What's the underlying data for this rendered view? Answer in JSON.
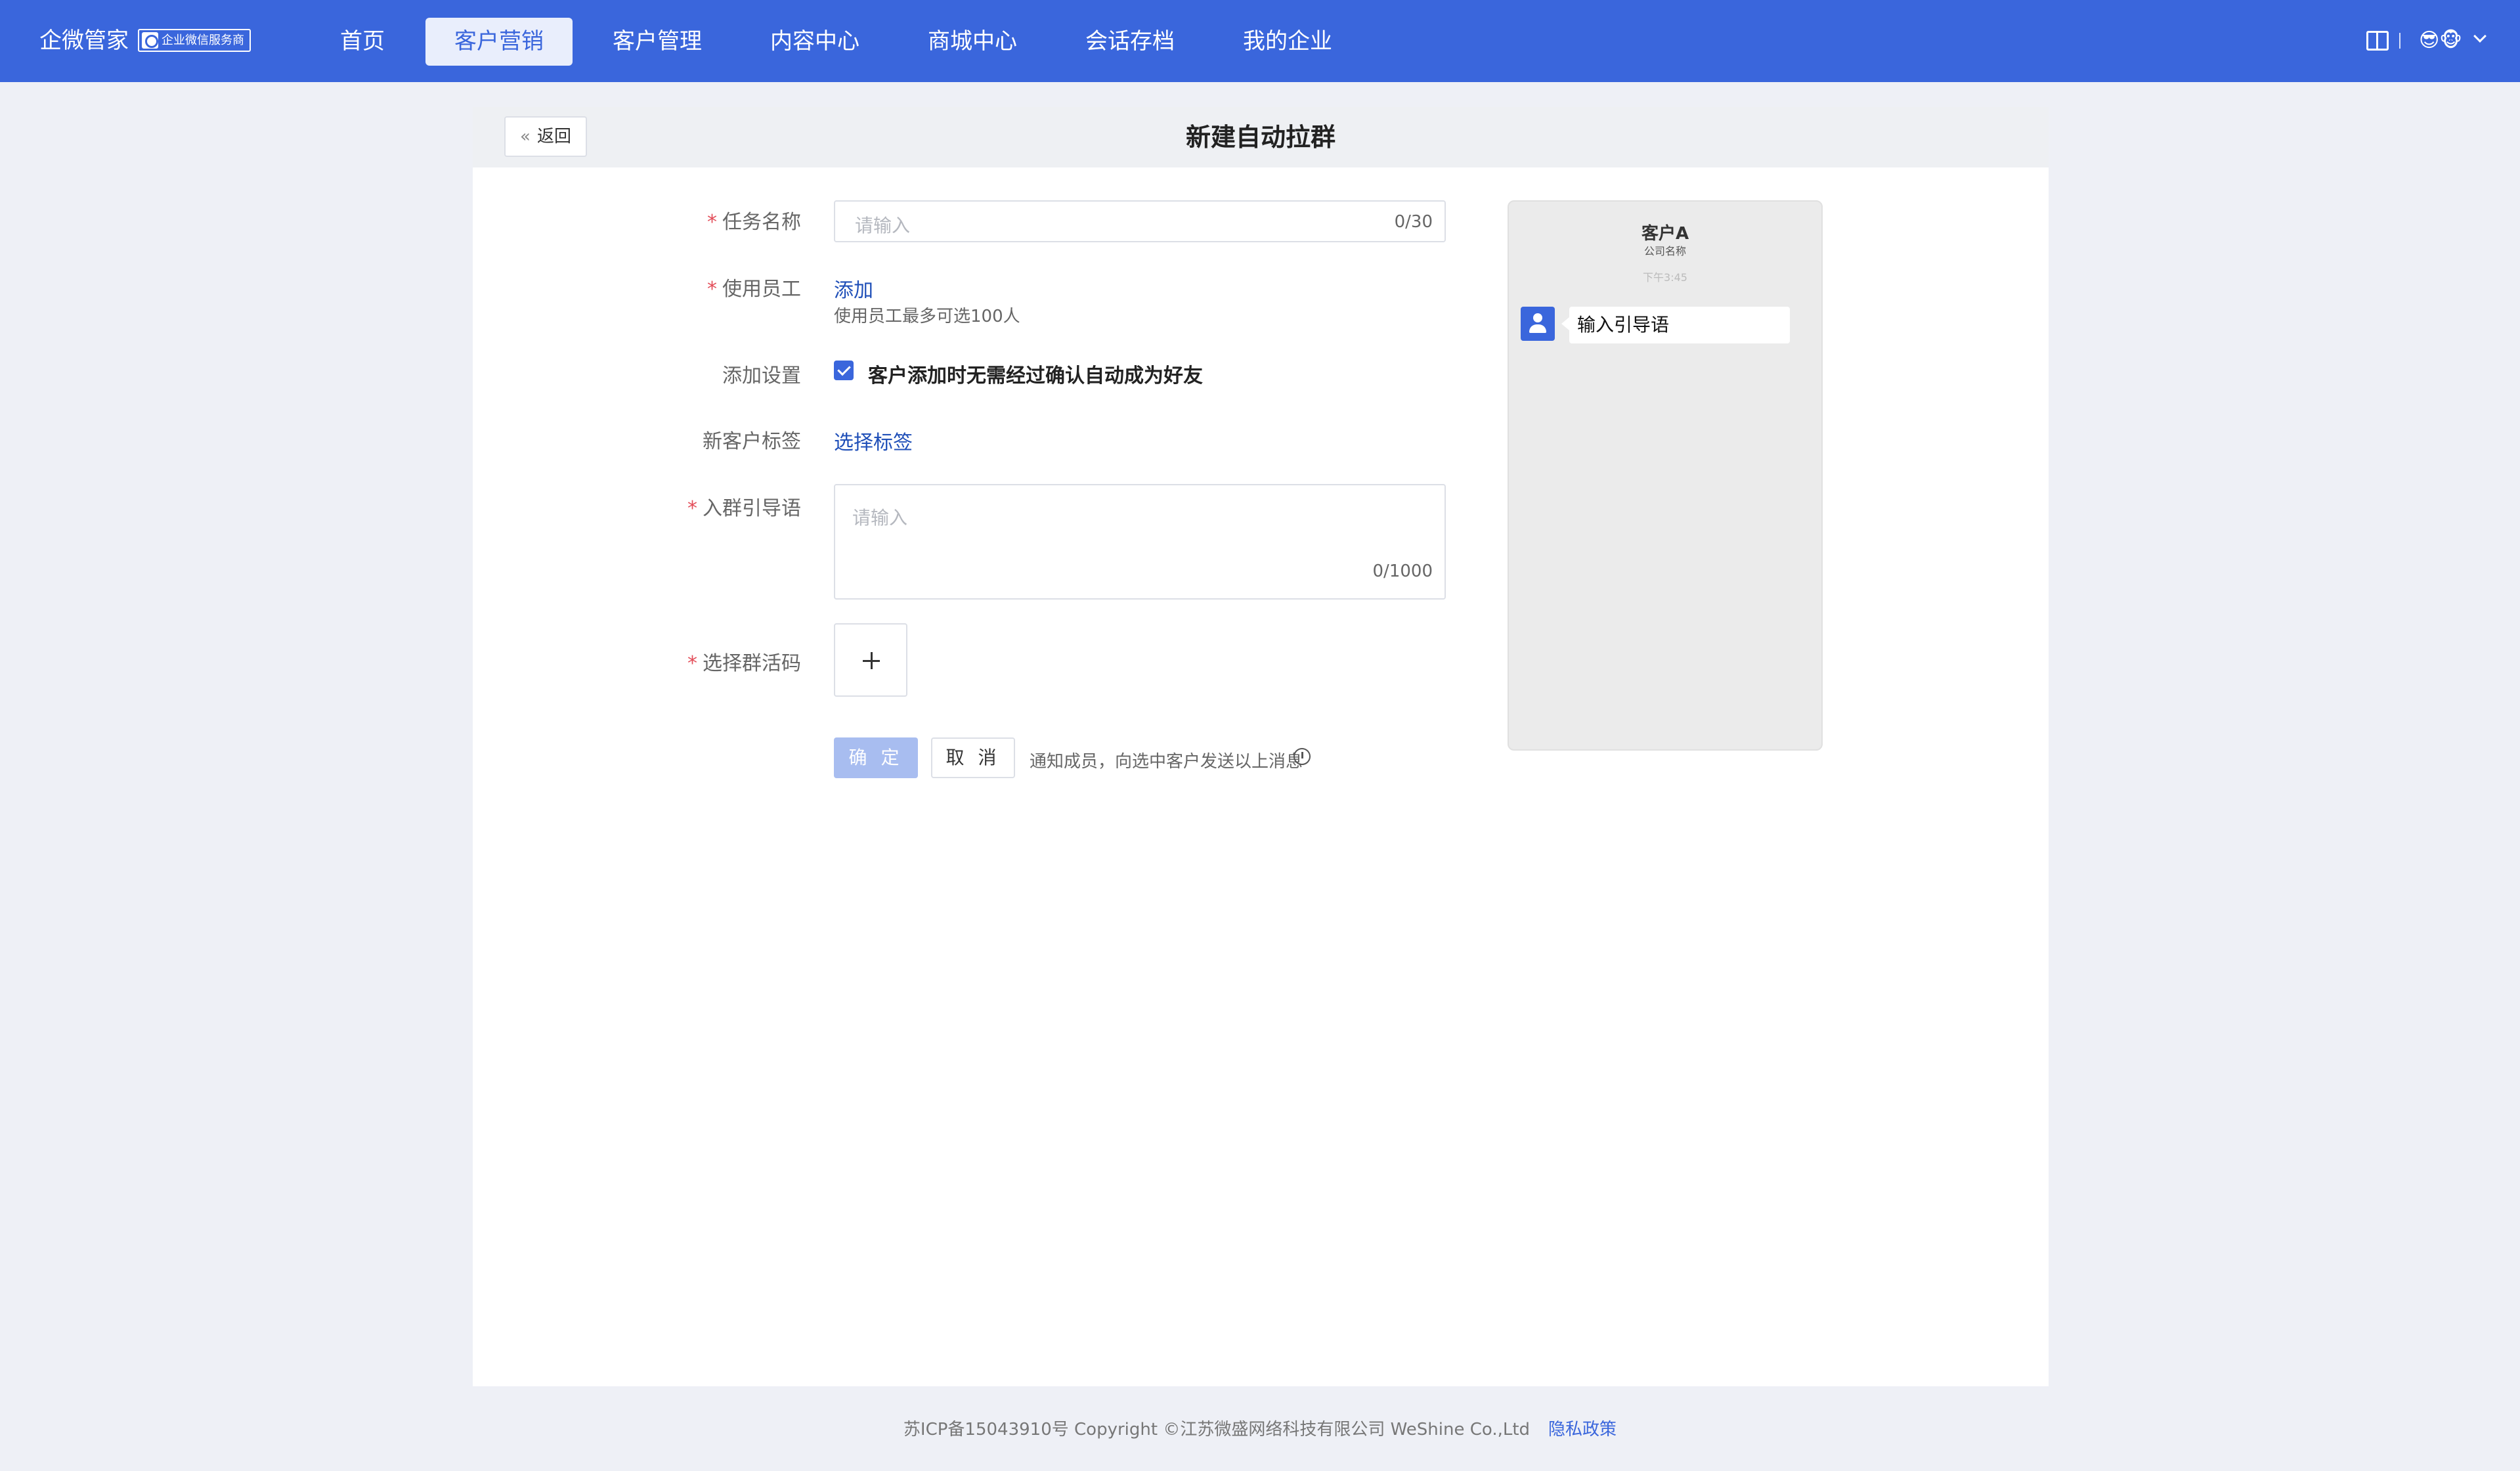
{
  "app": {
    "brand": "企微管家",
    "badge": "企业微信服务商"
  },
  "nav": {
    "items": [
      {
        "label": "首页",
        "active": false
      },
      {
        "label": "客户营销",
        "active": true
      },
      {
        "label": "客户管理",
        "active": false
      },
      {
        "label": "内容中心",
        "active": false
      },
      {
        "label": "商城中心",
        "active": false
      },
      {
        "label": "会话存档",
        "active": false
      },
      {
        "label": "我的企业",
        "active": false
      }
    ],
    "user_avatar": "😎🐵"
  },
  "header": {
    "back_label": "返回",
    "title": "新建自动拉群"
  },
  "form": {
    "task_name": {
      "label": "任务名称",
      "required_mark": "*",
      "placeholder": "请输入",
      "value": "",
      "counter": "0/30"
    },
    "staff": {
      "label": "使用员工",
      "required_mark": "*",
      "action": "添加",
      "hint": "使用员工最多可选100人"
    },
    "add_setting": {
      "label": "添加设置",
      "checked": true,
      "option": "客户添加时无需经过确认自动成为好友"
    },
    "new_tags": {
      "label": "新客户标签",
      "action": "选择标签"
    },
    "guide_text": {
      "label": "入群引导语",
      "required_mark": "*",
      "placeholder": "请输入",
      "value": "",
      "counter": "0/1000"
    },
    "group_code": {
      "label": "选择群活码",
      "required_mark": "*"
    },
    "confirm_label": "确 定",
    "cancel_label": "取 消",
    "notice": "通知成员，向选中客户发送以上消息"
  },
  "preview": {
    "customer_name": "客户A",
    "company": "公司名称",
    "time": "下午3:45",
    "message": "输入引导语"
  },
  "footer": {
    "copyright": "苏ICP备15043910号 Copyright ©江苏微盛网络科技有限公司 WeShine Co.,Ltd",
    "privacy": "隐私政策"
  },
  "colors": {
    "primary": "#3a66dc",
    "link": "#1f4fb8",
    "required": "#e34d59",
    "confirm_disabled": "#a8bdf0"
  }
}
